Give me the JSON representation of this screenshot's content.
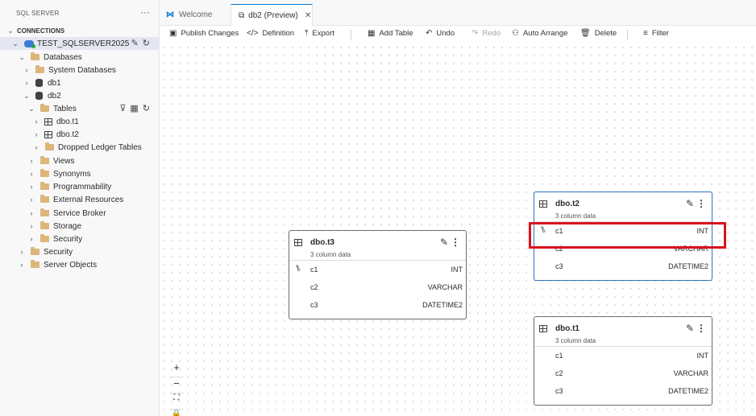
{
  "sidebar": {
    "title": "SQL SERVER",
    "more": "···",
    "connections_label": "CONNECTIONS",
    "tree": [
      {
        "label": "TEST_SQLSERVER2025"
      },
      {
        "label": "Databases"
      },
      {
        "label": "System Databases"
      },
      {
        "label": "db1"
      },
      {
        "label": "db2"
      },
      {
        "label": "Tables"
      },
      {
        "label": "dbo.t1"
      },
      {
        "label": "dbo.t2"
      },
      {
        "label": "Dropped Ledger Tables"
      },
      {
        "label": "Views"
      },
      {
        "label": "Synonyms"
      },
      {
        "label": "Programmability"
      },
      {
        "label": "External Resources"
      },
      {
        "label": "Service Broker"
      },
      {
        "label": "Storage"
      },
      {
        "label": "Security"
      },
      {
        "label": "Security"
      },
      {
        "label": "Server Objects"
      }
    ]
  },
  "tabs": [
    {
      "label": "Welcome"
    },
    {
      "label": "db2 (Preview)"
    }
  ],
  "toolbar": {
    "publish": "Publish Changes",
    "definition": "Definition",
    "export": "Export",
    "add_table": "Add Table",
    "undo": "Undo",
    "redo": "Redo",
    "auto_arrange": "Auto Arrange",
    "delete": "Delete",
    "filter": "Filter"
  },
  "tables": {
    "t3": {
      "name": "dbo.t3",
      "subtitle": "3 column data",
      "columns": [
        {
          "name": "c1",
          "type": "INT"
        },
        {
          "name": "c2",
          "type": "VARCHAR"
        },
        {
          "name": "c3",
          "type": "DATETIME2"
        }
      ]
    },
    "t2": {
      "name": "dbo.t2",
      "subtitle": "3 column data",
      "columns": [
        {
          "name": "c1",
          "type": "INT"
        },
        {
          "name": "c2",
          "type": "VARCHAR"
        },
        {
          "name": "c3",
          "type": "DATETIME2"
        }
      ]
    },
    "t1": {
      "name": "dbo.t1",
      "subtitle": "3 column data",
      "columns": [
        {
          "name": "c1",
          "type": "INT"
        },
        {
          "name": "c2",
          "type": "VARCHAR"
        },
        {
          "name": "c3",
          "type": "DATETIME2"
        }
      ]
    }
  },
  "zoom": {
    "in": "+",
    "out": "−"
  },
  "colors": {
    "accent": "#0078d4",
    "highlight": "#d8141e",
    "folder": "#dcb67a"
  }
}
